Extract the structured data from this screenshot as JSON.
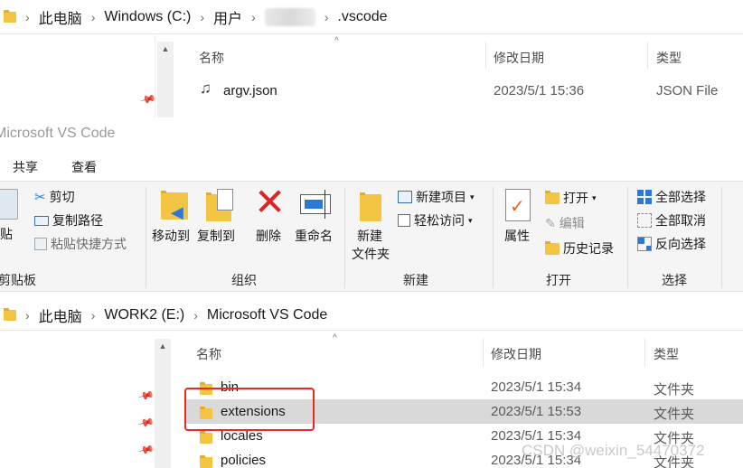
{
  "top_window": {
    "breadcrumb": [
      "此电脑",
      "Windows (C:)",
      "用户",
      ".vscode"
    ],
    "columns": {
      "name": "名称",
      "date": "修改日期",
      "type": "类型"
    },
    "files": [
      {
        "name": "argv.json",
        "date": "2023/5/1 15:36",
        "type": "JSON File"
      }
    ]
  },
  "ribbon_window": {
    "title": "Microsoft VS Code",
    "tabs": [
      "共享",
      "查看"
    ],
    "clipboard": {
      "paste": "贴",
      "cut": "剪切",
      "copy_path": "复制路径",
      "paste_shortcut": "粘贴快捷方式",
      "group": "剪贴板"
    },
    "organize": {
      "move_to": "移动到",
      "copy_to": "复制到",
      "delete": "删除",
      "rename": "重命名",
      "group": "组织"
    },
    "new": {
      "new_folder_line1": "新建",
      "new_folder_line2": "文件夹",
      "new_item": "新建项目",
      "easy_access": "轻松访问",
      "group": "新建"
    },
    "open": {
      "properties": "属性",
      "open": "打开",
      "edit": "编辑",
      "history": "历史记录",
      "group": "打开"
    },
    "select": {
      "select_all": "全部选择",
      "select_none": "全部取消",
      "invert": "反向选择",
      "group": "选择"
    }
  },
  "bottom_window": {
    "breadcrumb": [
      "此电脑",
      "WORK2 (E:)",
      "Microsoft VS Code"
    ],
    "columns": {
      "name": "名称",
      "date": "修改日期",
      "type": "类型"
    },
    "files": [
      {
        "name": "bin",
        "date": "2023/5/1 15:34",
        "type": "文件夹"
      },
      {
        "name": "extensions",
        "date": "2023/5/1 15:53",
        "type": "文件夹"
      },
      {
        "name": "locales",
        "date": "2023/5/1 15:34",
        "type": "文件夹"
      },
      {
        "name": "policies",
        "date": "2023/5/1 15:34",
        "type": "文件夹"
      }
    ]
  },
  "watermark": "CSDN @weixin_54470372",
  "colors": {
    "folder": "#f4c542",
    "selection": "#d9d9d9",
    "highlight_box": "#e8291c",
    "delete_red": "#d9262b",
    "accent_blue": "#2b79d6"
  }
}
